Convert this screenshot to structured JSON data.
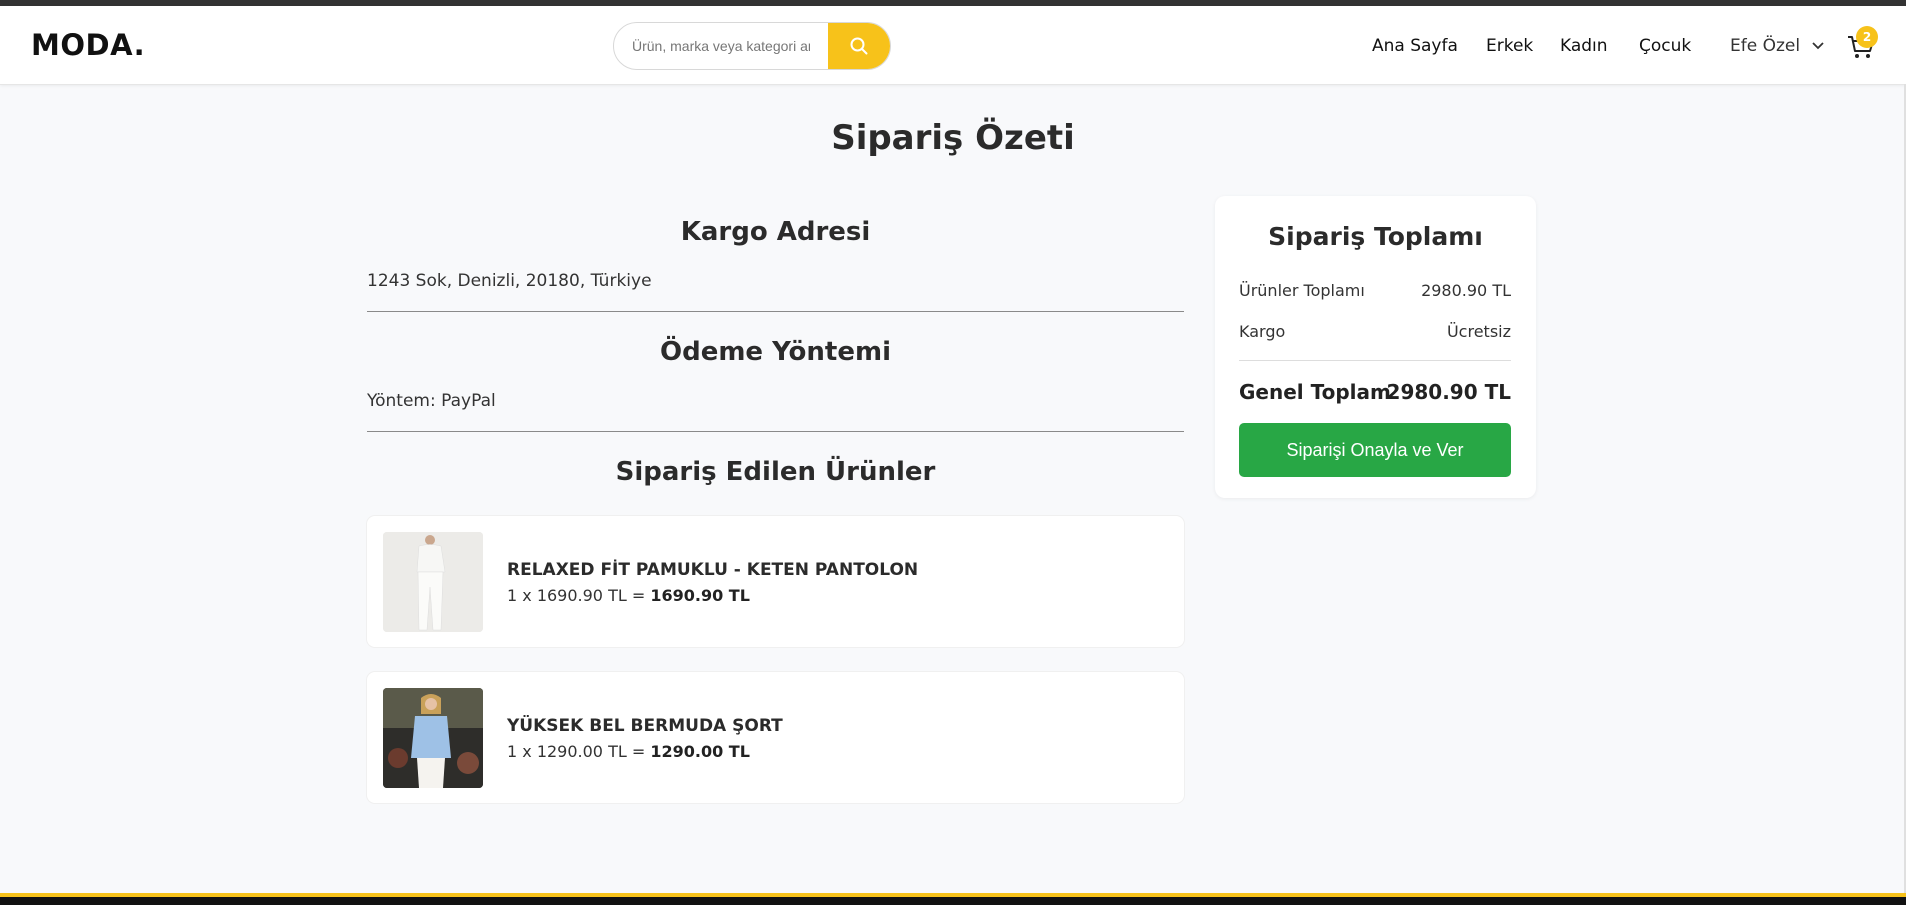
{
  "header": {
    "logo": "MODA.",
    "search": {
      "placeholder": "Ürün, marka veya kategori ara"
    },
    "nav": [
      "Ana Sayfa",
      "Erkek",
      "Kadın",
      "Çocuk"
    ],
    "user_name": "Efe Özel",
    "cart_count": "2"
  },
  "page_title": "Sipariş Özeti",
  "address": {
    "title": "Kargo Adresi",
    "text": "1243 Sok, Denizli, 20180, Türkiye"
  },
  "payment": {
    "title": "Ödeme Yöntemi",
    "text": "Yöntem: PayPal"
  },
  "items": {
    "title": "Sipariş Edilen Ürünler",
    "list": [
      {
        "name": "RELAXED FİT PAMUKLU - KETEN PANTOLON",
        "qty_price": "1 x 1690.90 TL = ",
        "total": "1690.90 TL"
      },
      {
        "name": "YÜKSEK BEL BERMUDA ŞORT",
        "qty_price": "1 x 1290.00 TL = ",
        "total": "1290.00 TL"
      }
    ]
  },
  "summary": {
    "title": "Sipariş Toplamı",
    "products_label": "Ürünler Toplamı",
    "products_value": "2980.90 TL",
    "shipping_label": "Kargo",
    "shipping_value": "Ücretsiz",
    "total_label": "Genel Toplam",
    "total_value": "2980.90 TL",
    "confirm_button": "Siparişi Onayla ve Ver"
  },
  "colors": {
    "accent": "#f7c21a",
    "confirm": "#28a745",
    "background": "#f8f9fb"
  }
}
